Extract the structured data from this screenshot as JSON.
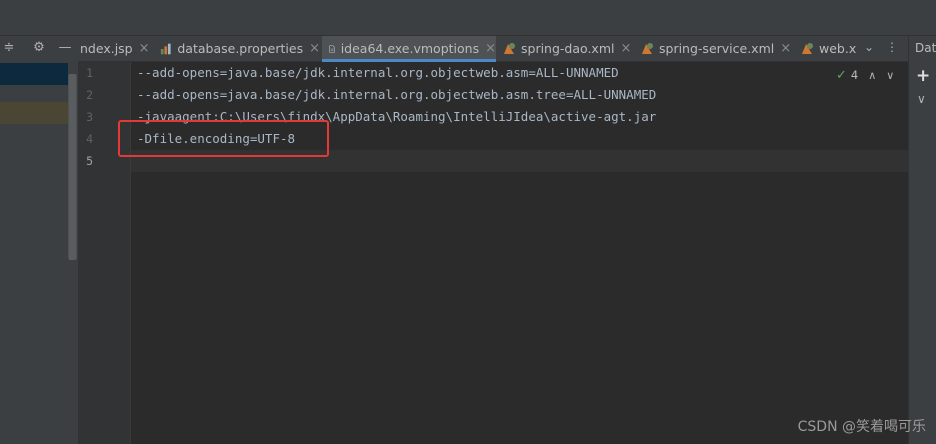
{
  "left_toolbar": {
    "icons": [
      "collapse-icon",
      "gear-icon",
      "minimize-icon"
    ],
    "glyphs": {
      "collapse": "≑",
      "gear": "⚙",
      "minimize": "—"
    }
  },
  "tabs": [
    {
      "label": "ndex.jsp",
      "icon": "jsp-file-icon",
      "close": "×"
    },
    {
      "label": "database.properties",
      "icon": "properties-file-icon",
      "close": "×"
    },
    {
      "label": "idea64.exe.vmoptions",
      "icon": "vmoptions-file-icon",
      "close": "×",
      "active": true
    },
    {
      "label": "spring-dao.xml",
      "icon": "spring-xml-icon",
      "close": "×"
    },
    {
      "label": "spring-service.xml",
      "icon": "spring-xml-icon",
      "close": "×"
    },
    {
      "label": "web.x",
      "icon": "web-xml-icon",
      "close": ""
    }
  ],
  "tab_menu_glyph": "⌄",
  "tab_more_glyph": "⋮",
  "editor": {
    "lines": [
      {
        "num": "1",
        "text": "--add-opens=java.base/jdk.internal.org.objectweb.asm=ALL-UNNAMED"
      },
      {
        "num": "2",
        "text": "--add-opens=java.base/jdk.internal.org.objectweb.asm.tree=ALL-UNNAMED"
      },
      {
        "num": "3",
        "text": "-javaagent:C:\\Users\\findx\\AppData\\Roaming\\IntelliJIdea\\active-agt.jar"
      },
      {
        "num": "4",
        "text": "-Dfile.encoding=UTF-8"
      },
      {
        "num": "5",
        "text": ""
      }
    ],
    "inspection_count": "4",
    "inspection_check": "✓",
    "nav_up": "∧",
    "nav_down": "∨"
  },
  "right_panel": {
    "title": "Data",
    "add_glyph": "+",
    "chevron_glyph": "∨"
  },
  "watermark": "CSDN @笑着喝可乐",
  "colors": {
    "accent": "#4a88c7",
    "highlight_box": "#e53935",
    "background": "#2b2b2b"
  }
}
